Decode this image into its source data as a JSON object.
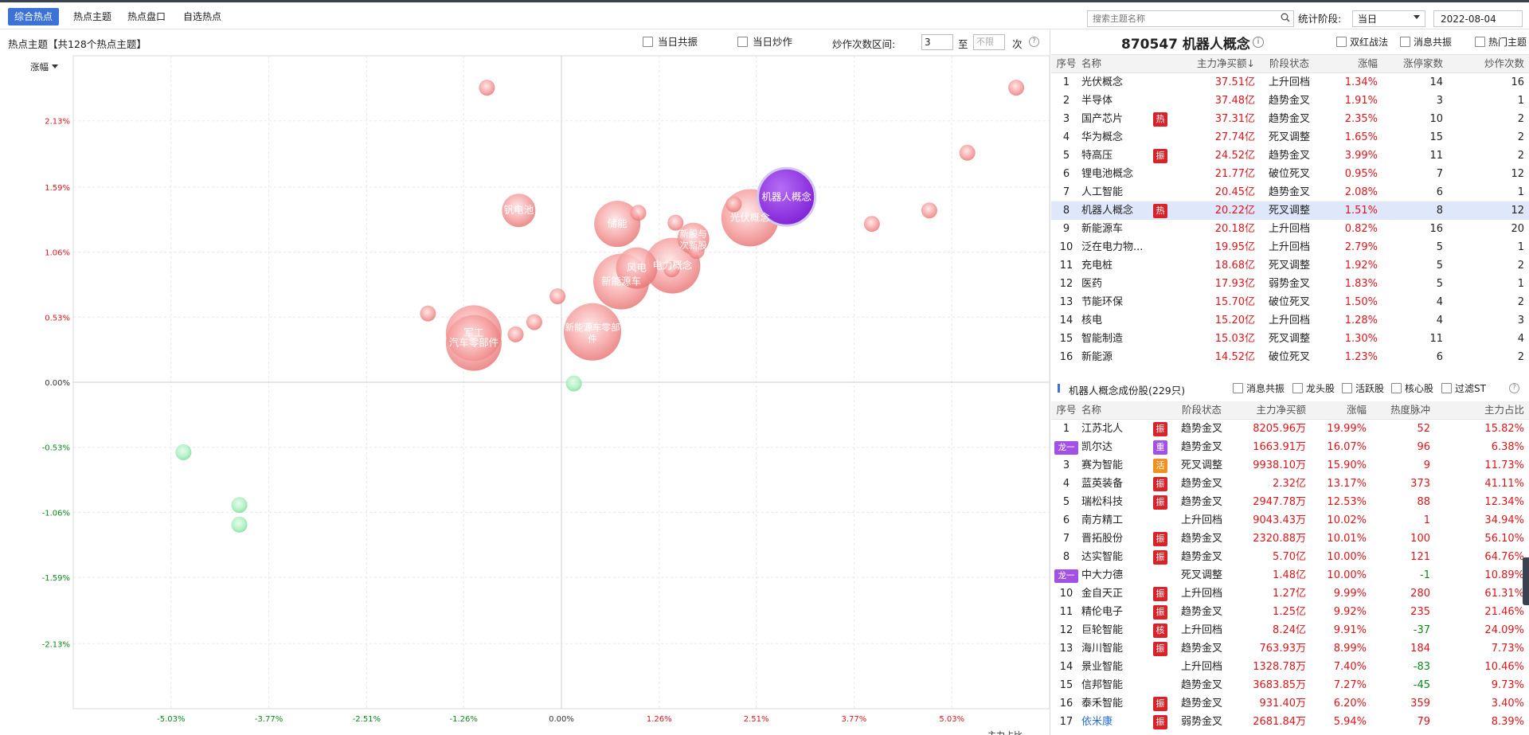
{
  "tabs": [
    "综合热点",
    "热点主题",
    "热点盘口",
    "自选热点"
  ],
  "search": {
    "placeholder": "搜索主题名称"
  },
  "stat": {
    "label": "统计阶段:",
    "value": "当日",
    "date": "2022-08-04"
  },
  "left": {
    "title": "热点主题【共128个热点主题】",
    "ck1": "当日共振",
    "ck2": "当日炒作",
    "range_label": "炒作次数区间:",
    "range_from": "3",
    "range_to_label": "至",
    "range_to_placeholder": "不限",
    "range_unit": "次",
    "sort_label": "涨幅",
    "x_axis_label": "主力占比"
  },
  "chart_data": {
    "type": "scatter",
    "xlabel": "主力占比",
    "ylabel": "涨幅",
    "x_ticks": [
      "-5.03%",
      "-3.77%",
      "-2.51%",
      "-1.26%",
      "0.00%",
      "1.26%",
      "2.51%",
      "3.77%",
      "5.03%"
    ],
    "y_ticks": [
      "2.13%",
      "1.59%",
      "1.06%",
      "0.53%",
      "0.00%",
      "-0.53%",
      "-1.06%",
      "-1.59%",
      "-2.13%"
    ],
    "xlim": [
      -6.29,
      6.29
    ],
    "ylim": [
      -2.66,
      2.66
    ],
    "grid": true,
    "points": [
      {
        "x": -0.96,
        "y": 2.4,
        "r": 10,
        "label": ""
      },
      {
        "x": 5.86,
        "y": 2.4,
        "r": 10,
        "label": ""
      },
      {
        "x": 5.23,
        "y": 1.87,
        "r": 10,
        "label": ""
      },
      {
        "x": 4.74,
        "y": 1.4,
        "r": 10,
        "label": ""
      },
      {
        "x": 4.0,
        "y": 1.29,
        "r": 10,
        "label": ""
      },
      {
        "x": -0.55,
        "y": 1.4,
        "r": 21,
        "label": "钒电池"
      },
      {
        "x": 0.72,
        "y": 1.29,
        "r": 29,
        "label": "储能"
      },
      {
        "x": 0.99,
        "y": 1.38,
        "r": 10,
        "label": ""
      },
      {
        "x": 1.47,
        "y": 1.3,
        "r": 10,
        "label": ""
      },
      {
        "x": 1.7,
        "y": 1.17,
        "r": 20,
        "label": "新股与次新股"
      },
      {
        "x": 1.74,
        "y": 1.07,
        "r": 10,
        "label": ""
      },
      {
        "x": 1.43,
        "y": 0.95,
        "r": 35,
        "label": "电力概念"
      },
      {
        "x": 0.97,
        "y": 0.93,
        "r": 26,
        "label": "风电"
      },
      {
        "x": 0.77,
        "y": 0.82,
        "r": 35,
        "label": "新能源车"
      },
      {
        "x": 1.42,
        "y": 0.92,
        "r": 10,
        "label": ""
      },
      {
        "x": 2.43,
        "y": 1.34,
        "r": 36,
        "label": "光伏概念"
      },
      {
        "x": 2.22,
        "y": 1.45,
        "r": 10,
        "label": ""
      },
      {
        "x": 2.9,
        "y": 1.51,
        "r": 36,
        "label": "机器人概念"
      },
      {
        "x": -0.05,
        "y": 0.7,
        "r": 10,
        "label": ""
      },
      {
        "x": -1.72,
        "y": 0.56,
        "r": 10,
        "label": ""
      },
      {
        "x": -1.13,
        "y": 0.4,
        "r": 35,
        "label": "军工"
      },
      {
        "x": -1.13,
        "y": 0.32,
        "r": 35,
        "label": "汽车零部件"
      },
      {
        "x": -0.59,
        "y": 0.39,
        "r": 10,
        "label": ""
      },
      {
        "x": -0.35,
        "y": 0.49,
        "r": 10,
        "label": ""
      },
      {
        "x": 0.4,
        "y": 0.41,
        "r": 36,
        "label": "新能源车零部件"
      },
      {
        "x": 0.16,
        "y": -0.01,
        "r": 10,
        "label": ""
      },
      {
        "x": -4.87,
        "y": -0.57,
        "r": 10,
        "label": ""
      },
      {
        "x": -4.15,
        "y": -1.0,
        "r": 10,
        "label": ""
      },
      {
        "x": -4.15,
        "y": -1.16,
        "r": 10,
        "label": ""
      }
    ]
  },
  "right": {
    "title": "870547 机器人概念",
    "ck1": "双红战法",
    "ck2": "消息共振",
    "ck3": "热门主题",
    "headers": [
      "序号",
      "名称",
      "主力净买额↓",
      "阶段状态",
      "涨幅",
      "涨停家数",
      "炒作次数"
    ],
    "rows": [
      {
        "n": "1",
        "name": "光伏概念",
        "tag": "",
        "amt": "37.51亿",
        "stage": "上升回档",
        "chg": "1.34%",
        "lim": "14",
        "cnt": "16"
      },
      {
        "n": "2",
        "name": "半导体",
        "tag": "",
        "amt": "37.48亿",
        "stage": "趋势金叉",
        "chg": "1.91%",
        "lim": "3",
        "cnt": "1"
      },
      {
        "n": "3",
        "name": "国产芯片",
        "tag": "热",
        "amt": "37.31亿",
        "stage": "趋势金叉",
        "chg": "2.35%",
        "lim": "10",
        "cnt": "2"
      },
      {
        "n": "4",
        "name": "华为概念",
        "tag": "",
        "amt": "27.74亿",
        "stage": "死叉调整",
        "chg": "1.65%",
        "lim": "15",
        "cnt": "2"
      },
      {
        "n": "5",
        "name": "特高压",
        "tag": "振",
        "amt": "24.52亿",
        "stage": "趋势金叉",
        "chg": "3.99%",
        "lim": "11",
        "cnt": "2"
      },
      {
        "n": "6",
        "name": "锂电池概念",
        "tag": "",
        "amt": "21.77亿",
        "stage": "破位死叉",
        "chg": "0.95%",
        "lim": "7",
        "cnt": "12"
      },
      {
        "n": "7",
        "name": "人工智能",
        "tag": "",
        "amt": "20.45亿",
        "stage": "趋势金叉",
        "chg": "2.08%",
        "lim": "6",
        "cnt": "1"
      },
      {
        "n": "8",
        "name": "机器人概念",
        "tag": "热",
        "amt": "20.22亿",
        "stage": "死叉调整",
        "chg": "1.51%",
        "lim": "8",
        "cnt": "12",
        "sel": true
      },
      {
        "n": "9",
        "name": "新能源车",
        "tag": "",
        "amt": "20.18亿",
        "stage": "上升回档",
        "chg": "0.82%",
        "lim": "16",
        "cnt": "20"
      },
      {
        "n": "10",
        "name": "泛在电力物...",
        "tag": "",
        "amt": "19.95亿",
        "stage": "上升回档",
        "chg": "2.79%",
        "lim": "5",
        "cnt": "1"
      },
      {
        "n": "11",
        "name": "充电桩",
        "tag": "",
        "amt": "18.68亿",
        "stage": "死叉调整",
        "chg": "1.92%",
        "lim": "5",
        "cnt": "2"
      },
      {
        "n": "12",
        "name": "医药",
        "tag": "",
        "amt": "17.93亿",
        "stage": "弱势金叉",
        "chg": "1.83%",
        "lim": "5",
        "cnt": "1"
      },
      {
        "n": "13",
        "name": "节能环保",
        "tag": "",
        "amt": "15.70亿",
        "stage": "破位死叉",
        "chg": "1.50%",
        "lim": "4",
        "cnt": "2"
      },
      {
        "n": "14",
        "name": "核电",
        "tag": "",
        "amt": "15.20亿",
        "stage": "上升回档",
        "chg": "1.28%",
        "lim": "4",
        "cnt": "3"
      },
      {
        "n": "15",
        "name": "智能制造",
        "tag": "",
        "amt": "15.03亿",
        "stage": "死叉调整",
        "chg": "1.30%",
        "lim": "11",
        "cnt": "4"
      },
      {
        "n": "16",
        "name": "新能源",
        "tag": "",
        "amt": "14.52亿",
        "stage": "破位死叉",
        "chg": "1.23%",
        "lim": "6",
        "cnt": "2"
      }
    ]
  },
  "stocks": {
    "title": "机器人概念成份股(229只)",
    "ck": [
      "消息共振",
      "龙头股",
      "活跃股",
      "核心股",
      "过滤ST"
    ],
    "headers": [
      "序号",
      "名称",
      "阶段状态",
      "主力净买额",
      "涨幅",
      "热度脉冲",
      "主力占比"
    ],
    "rows": [
      {
        "n": "1",
        "name": "江苏北人",
        "tag": "振",
        "stage": "趋势金叉",
        "amt": "8205.96万",
        "chg": "19.99%",
        "heat": "52",
        "ratio": "15.82%"
      },
      {
        "n": "龙一",
        "name": "凯尔达",
        "tag": "重",
        "stage": "趋势金叉",
        "amt": "1663.91万",
        "chg": "16.07%",
        "heat": "96",
        "ratio": "6.38%"
      },
      {
        "n": "3",
        "name": "赛为智能",
        "tag": "活",
        "stage": "死叉调整",
        "amt": "9938.10万",
        "chg": "15.90%",
        "heat": "9",
        "ratio": "11.73%"
      },
      {
        "n": "4",
        "name": "蓝英装备",
        "tag": "振",
        "stage": "趋势金叉",
        "amt": "2.32亿",
        "chg": "13.17%",
        "heat": "373",
        "ratio": "41.11%"
      },
      {
        "n": "5",
        "name": "瑞松科技",
        "tag": "振",
        "stage": "趋势金叉",
        "amt": "2947.78万",
        "chg": "12.53%",
        "heat": "88",
        "ratio": "12.34%"
      },
      {
        "n": "6",
        "name": "南方精工",
        "tag": "",
        "stage": "上升回档",
        "amt": "9043.43万",
        "chg": "10.02%",
        "heat": "1",
        "ratio": "34.94%"
      },
      {
        "n": "7",
        "name": "晋拓股份",
        "tag": "振",
        "stage": "趋势金叉",
        "amt": "2320.88万",
        "chg": "10.01%",
        "heat": "100",
        "ratio": "56.10%"
      },
      {
        "n": "8",
        "name": "达实智能",
        "tag": "振",
        "stage": "趋势金叉",
        "amt": "5.70亿",
        "chg": "10.00%",
        "heat": "121",
        "ratio": "64.76%"
      },
      {
        "n": "龙一",
        "name": "中大力德",
        "tag": "",
        "stage": "死叉调整",
        "amt": "1.48亿",
        "chg": "10.00%",
        "heat": "-1",
        "ratio": "10.89%"
      },
      {
        "n": "10",
        "name": "金自天正",
        "tag": "振",
        "stage": "上升回档",
        "amt": "1.27亿",
        "chg": "9.99%",
        "heat": "280",
        "ratio": "61.31%"
      },
      {
        "n": "11",
        "name": "精伦电子",
        "tag": "振",
        "stage": "趋势金叉",
        "amt": "1.25亿",
        "chg": "9.92%",
        "heat": "235",
        "ratio": "21.46%"
      },
      {
        "n": "12",
        "name": "巨轮智能",
        "tag": "核",
        "stage": "上升回档",
        "amt": "8.24亿",
        "chg": "9.91%",
        "heat": "-37",
        "ratio": "24.09%"
      },
      {
        "n": "13",
        "name": "海川智能",
        "tag": "振",
        "stage": "趋势金叉",
        "amt": "763.93万",
        "chg": "8.99%",
        "heat": "184",
        "ratio": "7.73%"
      },
      {
        "n": "14",
        "name": "景业智能",
        "tag": "",
        "stage": "上升回档",
        "amt": "1328.78万",
        "chg": "7.40%",
        "heat": "-83",
        "ratio": "10.46%"
      },
      {
        "n": "15",
        "name": "信邦智能",
        "tag": "",
        "stage": "趋势金叉",
        "amt": "3683.85万",
        "chg": "7.27%",
        "heat": "-45",
        "ratio": "9.73%"
      },
      {
        "n": "16",
        "name": "泰禾智能",
        "tag": "振",
        "stage": "趋势金叉",
        "amt": "931.40万",
        "chg": "6.20%",
        "heat": "359",
        "ratio": "3.40%"
      },
      {
        "n": "17",
        "name": "依米康",
        "tag": "振",
        "stage": "弱势金叉",
        "amt": "2681.84万",
        "chg": "5.94%",
        "heat": "79",
        "ratio": "8.39%",
        "blue": true
      }
    ]
  }
}
